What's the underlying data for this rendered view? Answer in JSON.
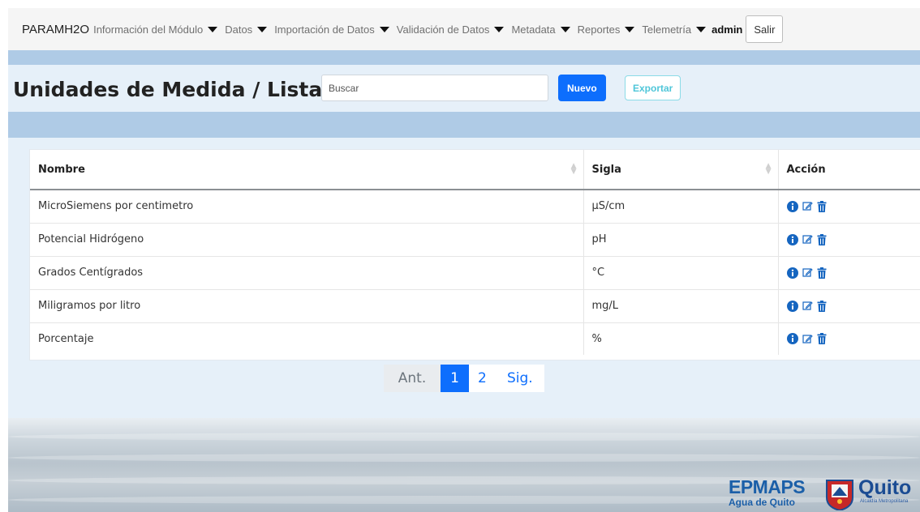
{
  "navbar": {
    "brand": "PARAMH2O",
    "items": [
      {
        "label": "Información del Módulo"
      },
      {
        "label": "Datos"
      },
      {
        "label": "Importación de Datos"
      },
      {
        "label": "Validación de Datos"
      },
      {
        "label": "Metadata"
      },
      {
        "label": "Reportes"
      },
      {
        "label": "Telemetría"
      }
    ],
    "user": "admin",
    "logout_label": "Salir"
  },
  "page": {
    "title": "Unidades de Medida / Listar",
    "search_placeholder": "Buscar",
    "new_label": "Nuevo",
    "export_label": "Exportar"
  },
  "table": {
    "headers": {
      "nombre": "Nombre",
      "sigla": "Sigla",
      "accion": "Acción"
    },
    "rows": [
      {
        "nombre": "MicroSiemens por centimetro",
        "sigla": "µS/cm"
      },
      {
        "nombre": "Potencial Hidrógeno",
        "sigla": "pH"
      },
      {
        "nombre": "Grados Centígrados",
        "sigla": "°C"
      },
      {
        "nombre": "Miligramos por litro",
        "sigla": "mg/L"
      },
      {
        "nombre": "Porcentaje",
        "sigla": "%"
      }
    ],
    "action_icons": [
      "info-icon",
      "edit-icon",
      "trash-icon"
    ]
  },
  "pagination": {
    "prev": "Ant.",
    "pages": [
      "1",
      "2"
    ],
    "current": "1",
    "next": "Sig."
  },
  "footer": {
    "logo_main": "EPMAPS",
    "logo_sub": "Agua de Quito",
    "logo_city": "Quito",
    "logo_alcaldia": "Alcaldía Metropolitana"
  },
  "colors": {
    "primary": "#0d6efd",
    "export": "#4fc6d9",
    "band": "#afcbe6",
    "content_bg": "#e6f0f9",
    "icon_blue": "#1565c0"
  }
}
